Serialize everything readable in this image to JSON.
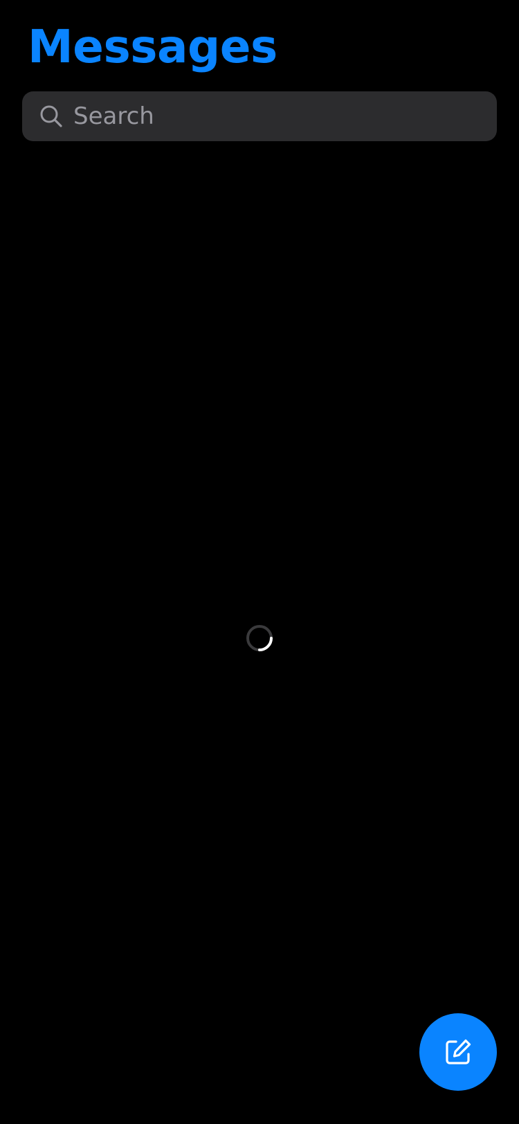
{
  "header": {
    "title": "Messages"
  },
  "search": {
    "placeholder": "Search",
    "value": "",
    "icon": "search-icon"
  },
  "loading": {
    "icon": "spinner-icon"
  },
  "compose": {
    "icon": "compose-icon"
  },
  "colors": {
    "background": "#000000",
    "accent": "#0a84ff",
    "search_field": "#2c2c2e",
    "placeholder": "#98989f",
    "spinner_track": "#3a3a3c",
    "spinner_arc": "#ffffff"
  }
}
